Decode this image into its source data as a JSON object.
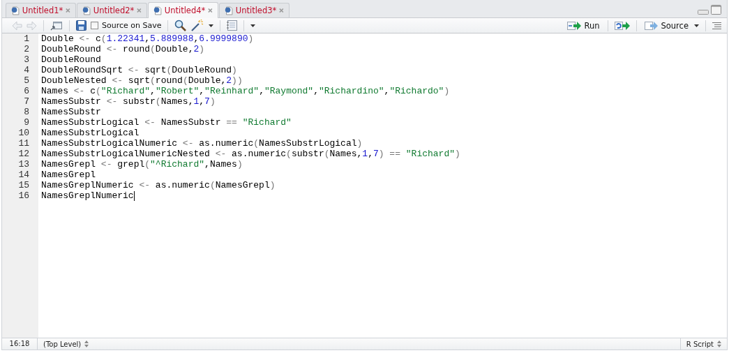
{
  "tabs": [
    {
      "label": "Untitled1*",
      "selected": false
    },
    {
      "label": "Untitled2*",
      "selected": false
    },
    {
      "label": "Untitled4*",
      "selected": true
    },
    {
      "label": "Untitled3*",
      "selected": false
    }
  ],
  "toolbar": {
    "source_on_save": {
      "label": "Source on Save",
      "checked": false
    },
    "run": {
      "label": "Run"
    },
    "source": {
      "label": "Source"
    }
  },
  "editor": {
    "lines": [
      {
        "number": "1",
        "cursor": false,
        "tokens": [
          {
            "kind": "plain",
            "text": "Double "
          },
          {
            "kind": "op",
            "text": "<-"
          },
          {
            "kind": "plain",
            "text": " c"
          },
          {
            "kind": "op",
            "text": "("
          },
          {
            "kind": "num",
            "text": "1.22341"
          },
          {
            "kind": "plain",
            "text": ","
          },
          {
            "kind": "num",
            "text": "5.889988"
          },
          {
            "kind": "plain",
            "text": ","
          },
          {
            "kind": "num",
            "text": "6.9999890"
          },
          {
            "kind": "op",
            "text": ")"
          }
        ]
      },
      {
        "number": "2",
        "cursor": false,
        "tokens": [
          {
            "kind": "plain",
            "text": "DoubleRound "
          },
          {
            "kind": "op",
            "text": "<-"
          },
          {
            "kind": "plain",
            "text": " round"
          },
          {
            "kind": "op",
            "text": "("
          },
          {
            "kind": "plain",
            "text": "Double,"
          },
          {
            "kind": "num",
            "text": "2"
          },
          {
            "kind": "op",
            "text": ")"
          }
        ]
      },
      {
        "number": "3",
        "cursor": false,
        "tokens": [
          {
            "kind": "plain",
            "text": "DoubleRound"
          }
        ]
      },
      {
        "number": "4",
        "cursor": false,
        "tokens": [
          {
            "kind": "plain",
            "text": "DoubleRoundSqrt "
          },
          {
            "kind": "op",
            "text": "<-"
          },
          {
            "kind": "plain",
            "text": " sqrt"
          },
          {
            "kind": "op",
            "text": "("
          },
          {
            "kind": "plain",
            "text": "DoubleRound"
          },
          {
            "kind": "op",
            "text": ")"
          }
        ]
      },
      {
        "number": "5",
        "cursor": false,
        "tokens": [
          {
            "kind": "plain",
            "text": "DoubleNested "
          },
          {
            "kind": "op",
            "text": "<-"
          },
          {
            "kind": "plain",
            "text": " sqrt"
          },
          {
            "kind": "op",
            "text": "("
          },
          {
            "kind": "plain",
            "text": "round"
          },
          {
            "kind": "op",
            "text": "("
          },
          {
            "kind": "plain",
            "text": "Double,"
          },
          {
            "kind": "num",
            "text": "2"
          },
          {
            "kind": "op",
            "text": "))"
          }
        ]
      },
      {
        "number": "6",
        "cursor": false,
        "tokens": [
          {
            "kind": "plain",
            "text": "Names "
          },
          {
            "kind": "op",
            "text": "<-"
          },
          {
            "kind": "plain",
            "text": " c"
          },
          {
            "kind": "op",
            "text": "("
          },
          {
            "kind": "str",
            "text": "\"Richard\""
          },
          {
            "kind": "plain",
            "text": ","
          },
          {
            "kind": "str",
            "text": "\"Robert\""
          },
          {
            "kind": "plain",
            "text": ","
          },
          {
            "kind": "str",
            "text": "\"Reinhard\""
          },
          {
            "kind": "plain",
            "text": ","
          },
          {
            "kind": "str",
            "text": "\"Raymond\""
          },
          {
            "kind": "plain",
            "text": ","
          },
          {
            "kind": "str",
            "text": "\"Richardino\""
          },
          {
            "kind": "plain",
            "text": ","
          },
          {
            "kind": "str",
            "text": "\"Richardo\""
          },
          {
            "kind": "op",
            "text": ")"
          }
        ]
      },
      {
        "number": "7",
        "cursor": false,
        "tokens": [
          {
            "kind": "plain",
            "text": "NamesSubstr "
          },
          {
            "kind": "op",
            "text": "<-"
          },
          {
            "kind": "plain",
            "text": " substr"
          },
          {
            "kind": "op",
            "text": "("
          },
          {
            "kind": "plain",
            "text": "Names,"
          },
          {
            "kind": "num",
            "text": "1"
          },
          {
            "kind": "plain",
            "text": ","
          },
          {
            "kind": "num",
            "text": "7"
          },
          {
            "kind": "op",
            "text": ")"
          }
        ]
      },
      {
        "number": "8",
        "cursor": false,
        "tokens": [
          {
            "kind": "plain",
            "text": "NamesSubstr"
          }
        ]
      },
      {
        "number": "9",
        "cursor": false,
        "tokens": [
          {
            "kind": "plain",
            "text": "NamesSubstrLogical "
          },
          {
            "kind": "op",
            "text": "<-"
          },
          {
            "kind": "plain",
            "text": " NamesSubstr"
          },
          {
            "kind": "op",
            "text": " == "
          },
          {
            "kind": "str",
            "text": "\"Richard\""
          }
        ]
      },
      {
        "number": "10",
        "cursor": false,
        "tokens": [
          {
            "kind": "plain",
            "text": "NamesSubstrLogical"
          }
        ]
      },
      {
        "number": "11",
        "cursor": false,
        "tokens": [
          {
            "kind": "plain",
            "text": "NamesSubstrLogicalNumeric "
          },
          {
            "kind": "op",
            "text": "<-"
          },
          {
            "kind": "plain",
            "text": " as.numeric"
          },
          {
            "kind": "op",
            "text": "("
          },
          {
            "kind": "plain",
            "text": "NamesSubstrLogical"
          },
          {
            "kind": "op",
            "text": ")"
          }
        ]
      },
      {
        "number": "12",
        "cursor": false,
        "tokens": [
          {
            "kind": "plain",
            "text": "NamesSubstrLogicalNumericNested "
          },
          {
            "kind": "op",
            "text": "<-"
          },
          {
            "kind": "plain",
            "text": " as.numeric"
          },
          {
            "kind": "op",
            "text": "("
          },
          {
            "kind": "plain",
            "text": "substr"
          },
          {
            "kind": "op",
            "text": "("
          },
          {
            "kind": "plain",
            "text": "Names,"
          },
          {
            "kind": "num",
            "text": "1"
          },
          {
            "kind": "plain",
            "text": ","
          },
          {
            "kind": "num",
            "text": "7"
          },
          {
            "kind": "op",
            "text": ") == "
          },
          {
            "kind": "str",
            "text": "\"Richard\""
          },
          {
            "kind": "op",
            "text": ")"
          }
        ]
      },
      {
        "number": "13",
        "cursor": false,
        "tokens": [
          {
            "kind": "plain",
            "text": "NamesGrepl "
          },
          {
            "kind": "op",
            "text": "<-"
          },
          {
            "kind": "plain",
            "text": " grepl"
          },
          {
            "kind": "op",
            "text": "("
          },
          {
            "kind": "str",
            "text": "\"^Richard\""
          },
          {
            "kind": "plain",
            "text": ",Names"
          },
          {
            "kind": "op",
            "text": ")"
          }
        ]
      },
      {
        "number": "14",
        "cursor": false,
        "tokens": [
          {
            "kind": "plain",
            "text": "NamesGrepl"
          }
        ]
      },
      {
        "number": "15",
        "cursor": false,
        "tokens": [
          {
            "kind": "plain",
            "text": "NamesGreplNumeric "
          },
          {
            "kind": "op",
            "text": "<-"
          },
          {
            "kind": "plain",
            "text": " as.numeric"
          },
          {
            "kind": "op",
            "text": "("
          },
          {
            "kind": "plain",
            "text": "NamesGrepl"
          },
          {
            "kind": "op",
            "text": ")"
          }
        ]
      },
      {
        "number": "16",
        "cursor": true,
        "tokens": [
          {
            "kind": "plain",
            "text": "NamesGreplNumeric"
          }
        ]
      }
    ]
  },
  "status_bar": {
    "position": "16:18",
    "scope": "(Top Level)",
    "file_type": "R Script"
  }
}
